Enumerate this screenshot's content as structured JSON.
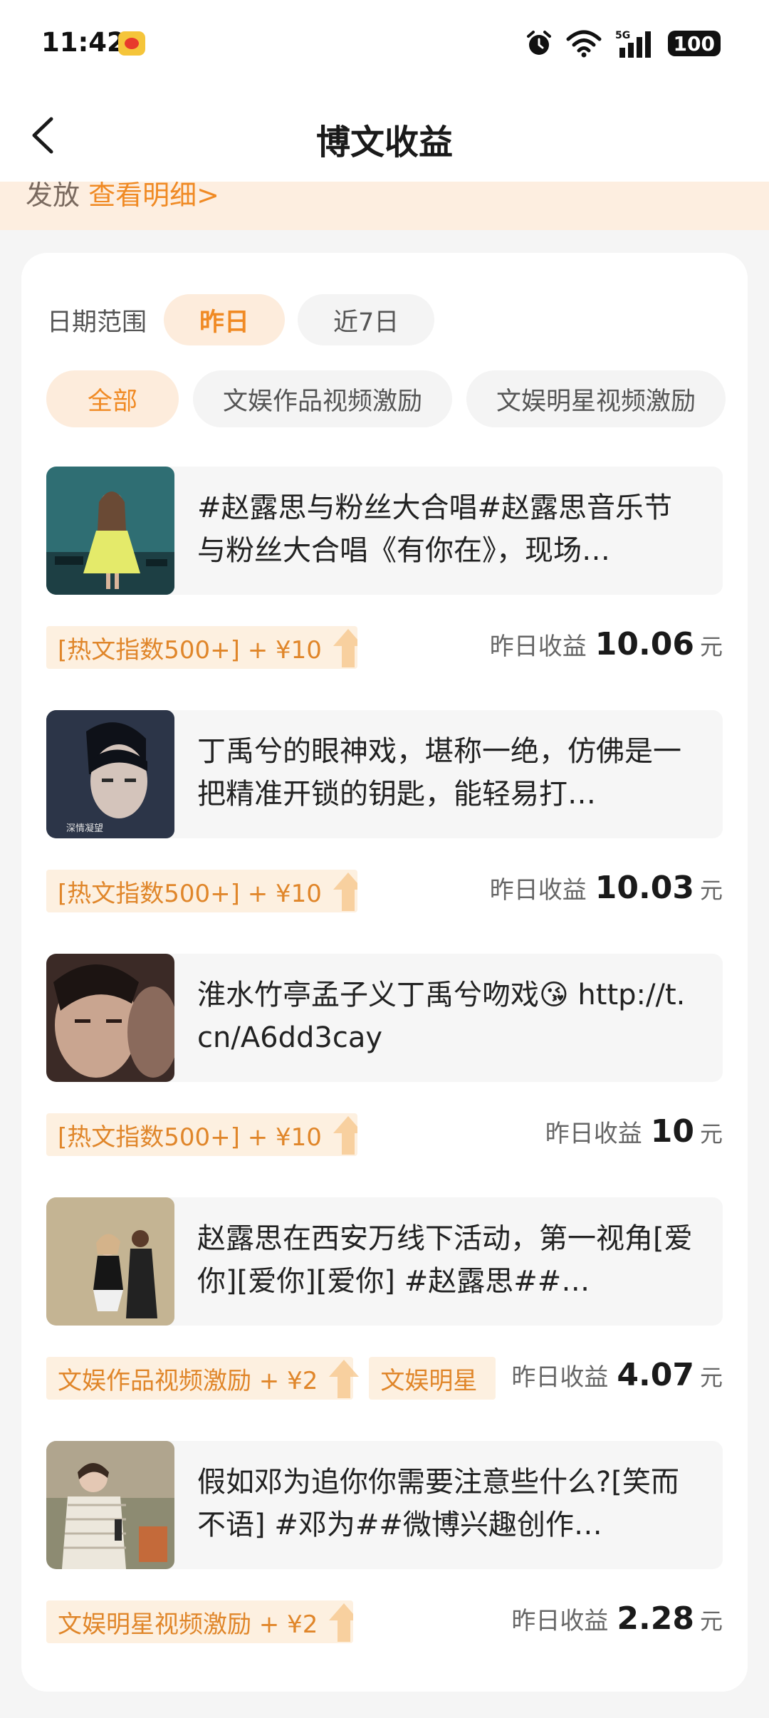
{
  "status": {
    "time": "11:42",
    "app_icon": "weibo-icon",
    "signal": "5G",
    "battery": "100"
  },
  "header": {
    "title": "博文收益"
  },
  "banner": {
    "text": "发放",
    "link": "查看明细>"
  },
  "filters": {
    "label": "日期范围",
    "options": [
      {
        "label": "昨日",
        "active": true
      },
      {
        "label": "近7日",
        "active": false
      }
    ]
  },
  "tabs": [
    {
      "label": "全部",
      "active": true
    },
    {
      "label": "文娱作品视频激励",
      "active": false
    },
    {
      "label": "文娱明星视频激励",
      "active": false
    }
  ],
  "posts": [
    {
      "text": "#赵露思与粉丝大合唱#赵露思音乐节与粉丝大合唱《有你在》，现场…",
      "tags": [
        "[热文指数500+] + ¥10"
      ],
      "earn_label": "昨日收益",
      "earn_value": "10.06",
      "earn_unit": "元"
    },
    {
      "text": "丁禹兮的眼神戏，堪称一绝，仿佛是一把精准开锁的钥匙，能轻易打…",
      "thumb_caption": "深情凝望",
      "tags": [
        "[热文指数500+] + ¥10"
      ],
      "earn_label": "昨日收益",
      "earn_value": "10.03",
      "earn_unit": "元"
    },
    {
      "text": "淮水竹亭孟子义丁禹兮吻戏😘 http://t.cn/A6dd3cay",
      "tags": [
        "[热文指数500+] + ¥10"
      ],
      "earn_label": "昨日收益",
      "earn_value": "10",
      "earn_unit": "元"
    },
    {
      "text": "赵露思在西安万线下活动，第一视角[爱你][爱你][爱你] #赵露思##…",
      "tags": [
        "文娱作品视频激励 + ¥2",
        "文娱明星"
      ],
      "earn_label": "昨日收益",
      "earn_value": "4.07",
      "earn_unit": "元"
    },
    {
      "text": "假如邓为追你你需要注意些什么?[笑而不语] #邓为##微博兴趣创作…",
      "tags": [
        "文娱明星视频激励 + ¥2"
      ],
      "earn_label": "昨日收益",
      "earn_value": "2.28",
      "earn_unit": "元"
    }
  ]
}
